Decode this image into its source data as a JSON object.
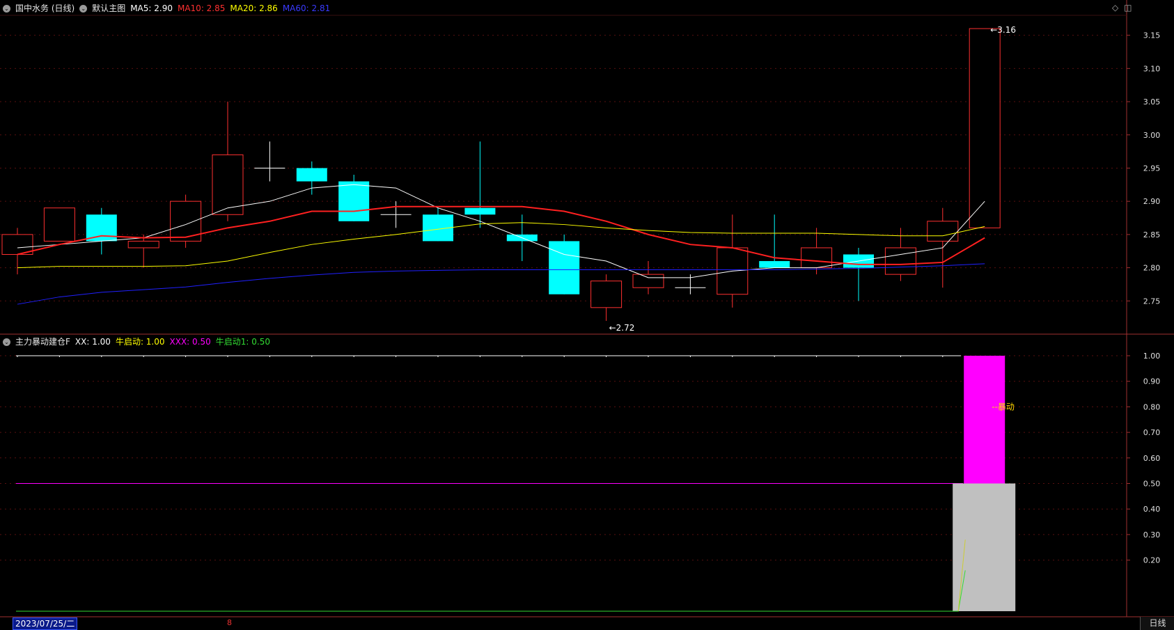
{
  "main_header": {
    "security": "国中水务 (日线)",
    "template": "默认主图",
    "ma5": "MA5: 2.90",
    "ma10": "MA10: 2.85",
    "ma20": "MA20: 2.86",
    "ma60": "MA60: 2.81"
  },
  "indicator_header": {
    "name": "主力暴动建仓F",
    "xx": "XX: 1.00",
    "niu": "牛启动: 1.00",
    "xxx": "XXX: 0.50",
    "niu1": "牛启动1: 0.50"
  },
  "window_controls": {
    "diamond": "◇",
    "restore": "◫"
  },
  "bottom": {
    "date": "2023/07/25/二",
    "cursor": "8",
    "period": "日线"
  },
  "colors": {
    "up": "#ff3030",
    "down": "#00ffff",
    "ma5": "#ffffff",
    "ma10": "#ff2020",
    "ma20": "#ffff00",
    "ma60": "#2020ff",
    "magenta": "#ff00ff",
    "grey": "#c0c0c0",
    "green": "#33dd33"
  },
  "chart_data": [
    {
      "type": "candlestick",
      "title": "国中水务 (日线)",
      "ylim": [
        2.7,
        3.18
      ],
      "yticks": [
        "3.15",
        "3.10",
        "3.05",
        "3.00",
        "2.95",
        "2.90",
        "2.85",
        "2.80",
        "2.75"
      ],
      "candles": [
        {
          "o": 2.82,
          "h": 2.86,
          "l": 2.79,
          "c": 2.85
        },
        {
          "o": 2.84,
          "h": 2.89,
          "l": 2.84,
          "c": 2.89
        },
        {
          "o": 2.88,
          "h": 2.89,
          "l": 2.82,
          "c": 2.84
        },
        {
          "o": 2.83,
          "h": 2.85,
          "l": 2.8,
          "c": 2.84
        },
        {
          "o": 2.84,
          "h": 2.91,
          "l": 2.83,
          "c": 2.9
        },
        {
          "o": 2.88,
          "h": 3.05,
          "l": 2.87,
          "c": 2.97
        },
        {
          "o": 2.95,
          "h": 2.99,
          "l": 2.93,
          "c": 2.95
        },
        {
          "o": 2.95,
          "h": 2.96,
          "l": 2.91,
          "c": 2.93
        },
        {
          "o": 2.93,
          "h": 2.94,
          "l": 2.87,
          "c": 2.87
        },
        {
          "o": 2.88,
          "h": 2.9,
          "l": 2.86,
          "c": 2.88
        },
        {
          "o": 2.88,
          "h": 2.89,
          "l": 2.84,
          "c": 2.84
        },
        {
          "o": 2.89,
          "h": 2.99,
          "l": 2.86,
          "c": 2.88
        },
        {
          "o": 2.85,
          "h": 2.88,
          "l": 2.81,
          "c": 2.84
        },
        {
          "o": 2.84,
          "h": 2.85,
          "l": 2.76,
          "c": 2.76
        },
        {
          "o": 2.74,
          "h": 2.79,
          "l": 2.72,
          "c": 2.78
        },
        {
          "o": 2.77,
          "h": 2.81,
          "l": 2.76,
          "c": 2.79
        },
        {
          "o": 2.77,
          "h": 2.79,
          "l": 2.76,
          "c": 2.77
        },
        {
          "o": 2.76,
          "h": 2.88,
          "l": 2.74,
          "c": 2.83
        },
        {
          "o": 2.81,
          "h": 2.88,
          "l": 2.8,
          "c": 2.8
        },
        {
          "o": 2.8,
          "h": 2.86,
          "l": 2.79,
          "c": 2.83
        },
        {
          "o": 2.82,
          "h": 2.83,
          "l": 2.75,
          "c": 2.8
        },
        {
          "o": 2.79,
          "h": 2.86,
          "l": 2.78,
          "c": 2.83
        },
        {
          "o": 2.84,
          "h": 2.89,
          "l": 2.77,
          "c": 2.87
        },
        {
          "o": 2.86,
          "h": 3.16,
          "l": 2.86,
          "c": 3.16
        }
      ],
      "ma": [
        {
          "name": "MA5",
          "color": "#ffffff",
          "values": [
            2.83,
            2.835,
            2.84,
            2.845,
            2.865,
            2.89,
            2.9,
            2.92,
            2.925,
            2.92,
            2.89,
            2.87,
            2.845,
            2.82,
            2.81,
            2.785,
            2.785,
            2.795,
            2.8,
            2.8,
            2.81,
            2.82,
            2.83,
            2.9
          ]
        },
        {
          "name": "MA10",
          "color": "#ff2020",
          "values": [
            2.82,
            2.835,
            2.848,
            2.845,
            2.846,
            2.86,
            2.87,
            2.885,
            2.885,
            2.892,
            2.892,
            2.892,
            2.892,
            2.885,
            2.87,
            2.85,
            2.835,
            2.83,
            2.815,
            2.81,
            2.805,
            2.805,
            2.808,
            2.845
          ]
        },
        {
          "name": "MA20",
          "color": "#ffff00",
          "values": [
            2.8,
            2.802,
            2.802,
            2.802,
            2.803,
            2.81,
            2.823,
            2.835,
            2.843,
            2.85,
            2.858,
            2.866,
            2.868,
            2.865,
            2.86,
            2.856,
            2.853,
            2.852,
            2.852,
            2.852,
            2.85,
            2.848,
            2.848,
            2.862
          ]
        },
        {
          "name": "MA60",
          "color": "#2020ff",
          "values": [
            2.745,
            2.756,
            2.763,
            2.767,
            2.771,
            2.778,
            2.784,
            2.789,
            2.793,
            2.795,
            2.796,
            2.797,
            2.797,
            2.797,
            2.797,
            2.797,
            2.797,
            2.797,
            2.797,
            2.798,
            2.799,
            2.801,
            2.803,
            2.806
          ]
        }
      ],
      "annotations": [
        {
          "label": "3.16",
          "candle": 23,
          "value": 3.16
        },
        {
          "label": "2.72",
          "candle": 14,
          "value": 2.72
        }
      ]
    },
    {
      "type": "bar",
      "title": "主力暴动建仓F",
      "ylim": [
        0,
        1.03
      ],
      "yticks": [
        "1.00",
        "0.90",
        "0.80",
        "0.70",
        "0.60",
        "0.50",
        "0.40",
        "0.30",
        "0.20"
      ],
      "xx": 1.0,
      "xxx": 0.5,
      "niu_qidong": [
        {
          "candle": 23,
          "from": 0.5,
          "to": 1.0
        }
      ],
      "niu_qidong1": [
        {
          "candle": 23,
          "from": 0,
          "to": 0.5
        }
      ],
      "green_line": {
        "flat": 0,
        "last": [
          0.16,
          0.28
        ]
      },
      "annotation": {
        "label": "--暴动",
        "value": 0.8
      }
    }
  ]
}
